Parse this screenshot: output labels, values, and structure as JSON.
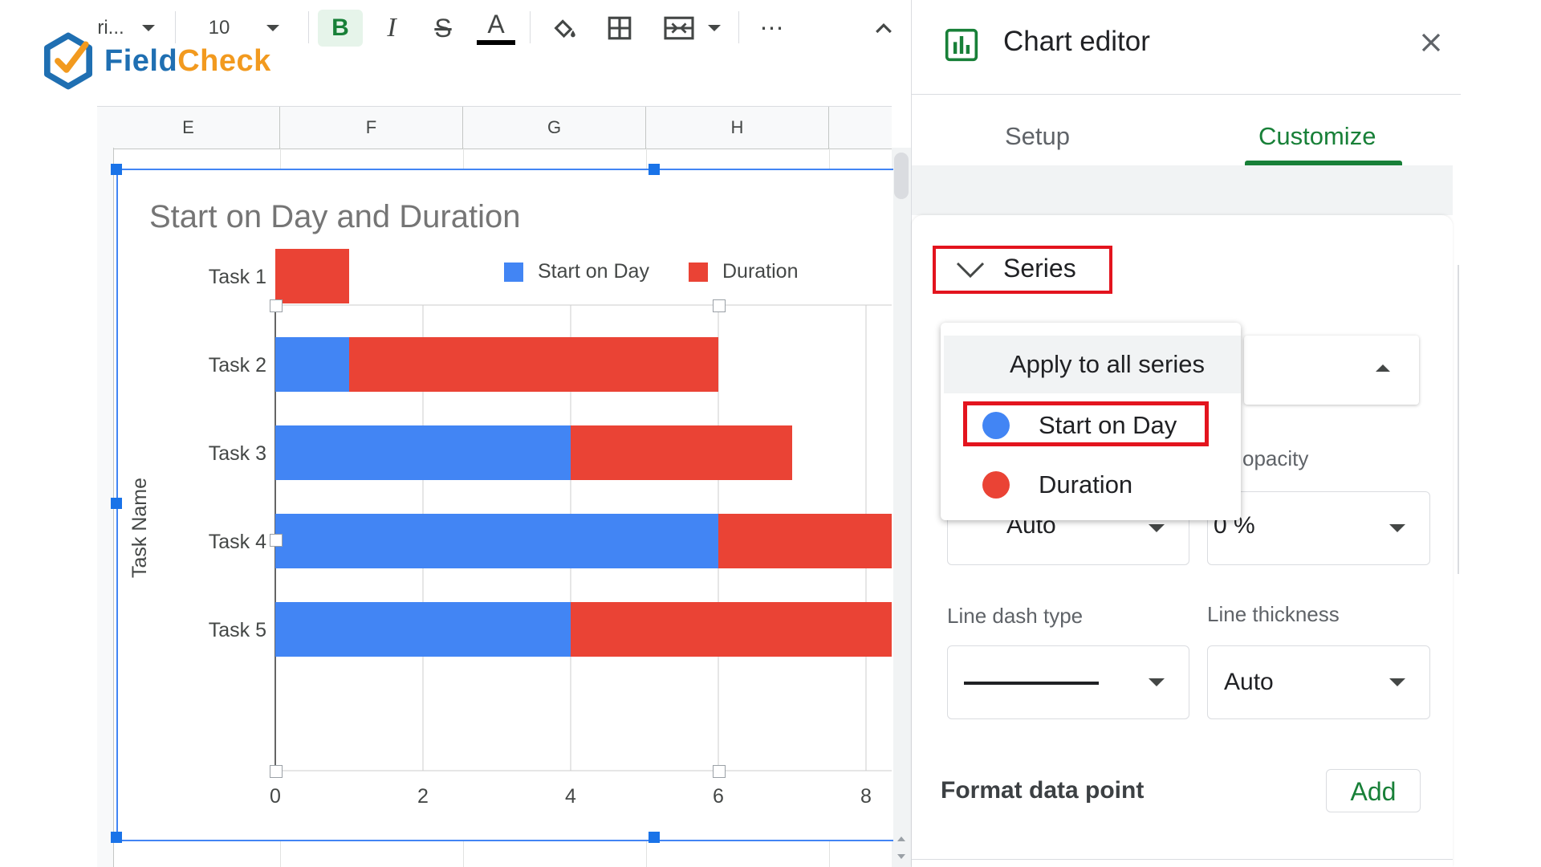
{
  "toolbar": {
    "font_name": "ri...",
    "font_size": "10",
    "bold": "B",
    "italic": "I",
    "strike": "S",
    "text_color": "A",
    "more": "⋯"
  },
  "logo": {
    "part1": "Field",
    "part2": "Check"
  },
  "sheet": {
    "columns": [
      "E",
      "F",
      "G",
      "H"
    ]
  },
  "chart_data": {
    "type": "bar",
    "orientation": "horizontal",
    "stacked": true,
    "title": "Start on Day and Duration",
    "ylabel": "Task Name",
    "xlabel": "",
    "categories": [
      "Task 1",
      "Task 2",
      "Task 3",
      "Task 4",
      "Task 5"
    ],
    "series": [
      {
        "name": "Start on Day",
        "color": "#4285f4",
        "values": [
          0,
          1,
          4,
          6,
          4
        ]
      },
      {
        "name": "Duration",
        "color": "#ea4335",
        "values": [
          1,
          5,
          3,
          3,
          5
        ]
      }
    ],
    "xlim": [
      0,
      8.3
    ],
    "xticks": [
      "0",
      "2",
      "4",
      "6",
      "8"
    ],
    "legend_position": "top-right",
    "grid": true
  },
  "editor": {
    "title": "Chart editor",
    "tabs": [
      "Setup",
      "Customize"
    ],
    "active_tab": "Customize",
    "section": "Series",
    "series_menu": {
      "all": "Apply to all series",
      "items": [
        {
          "label": "Start on Day",
          "color": "#4285f4"
        },
        {
          "label": "Duration",
          "color": "#ea4335"
        }
      ]
    },
    "point_size_value": "Auto",
    "opacity_label": "opacity",
    "opacity_value": "0 %",
    "line_dash_label": "Line dash type",
    "line_thickness_label": "Line thickness",
    "line_thickness_value": "Auto",
    "format_point_label": "Format data point",
    "add_label": "Add"
  }
}
